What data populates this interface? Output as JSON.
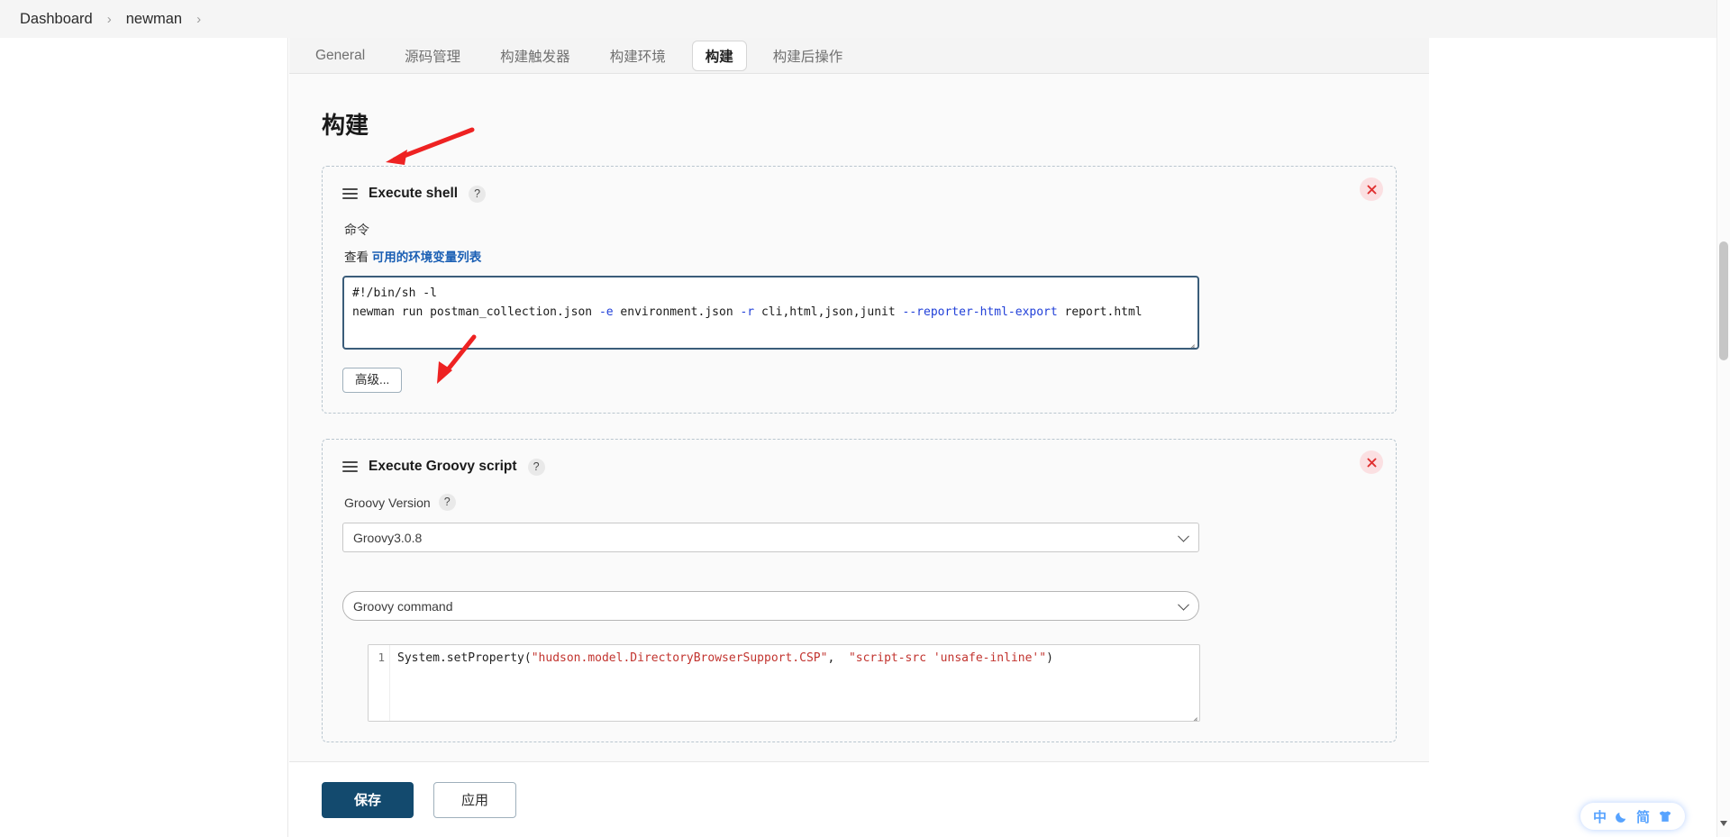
{
  "breadcrumb": {
    "items": [
      {
        "label": "Dashboard"
      },
      {
        "label": "newman"
      }
    ],
    "separator": "›"
  },
  "tabs": [
    {
      "label": "General",
      "active": false
    },
    {
      "label": "源码管理",
      "active": false
    },
    {
      "label": "构建触发器",
      "active": false
    },
    {
      "label": "构建环境",
      "active": false
    },
    {
      "label": "构建",
      "active": true
    },
    {
      "label": "构建后操作",
      "active": false
    }
  ],
  "page": {
    "title": "构建"
  },
  "builders": [
    {
      "title": "Execute shell",
      "help": "?",
      "command_label": "命令",
      "hint_prefix": "查看 ",
      "hint_link": "可用的环境变量列表",
      "script_line1": "#!/bin/sh -l",
      "script_line2_a": "newman run postman_collection.json ",
      "script_line2_opt1": "-e",
      "script_line2_b": " environment.json ",
      "script_line2_opt2": "-r",
      "script_line2_c": " cli,html,json,junit ",
      "script_line2_opt3": "--reporter-html-export",
      "script_line2_d": " report.html",
      "advanced_label": "高级...",
      "delete_label": "×"
    },
    {
      "title": "Execute Groovy script",
      "help": "?",
      "version_label": "Groovy Version",
      "version_help": "?",
      "version_value": "Groovy3.0.8",
      "command_type_value": "Groovy command",
      "editor_line_number": "1",
      "code_a": "System.setProperty(",
      "code_str1": "\"hudson.model.DirectoryBrowserSupport.CSP\"",
      "code_b": ",  ",
      "code_str2": "\"script-src 'unsafe-inline'\"",
      "code_c": ")",
      "delete_label": "×"
    }
  ],
  "footer": {
    "save_label": "保存",
    "apply_label": "应用"
  },
  "lang_widget": {
    "chinese_label": "中",
    "moon_icon": "moon-icon",
    "simplified_label": "简",
    "shirt_icon": "tshirt-icon"
  },
  "colors": {
    "accent_primary": "#134a6e",
    "link": "#1a5fb4",
    "annotation_arrow": "#ee2222",
    "code_option": "#2140d8",
    "code_string": "#c2342f",
    "delete_bg": "#fbe0e2",
    "lang_blue": "#57a3ff"
  }
}
